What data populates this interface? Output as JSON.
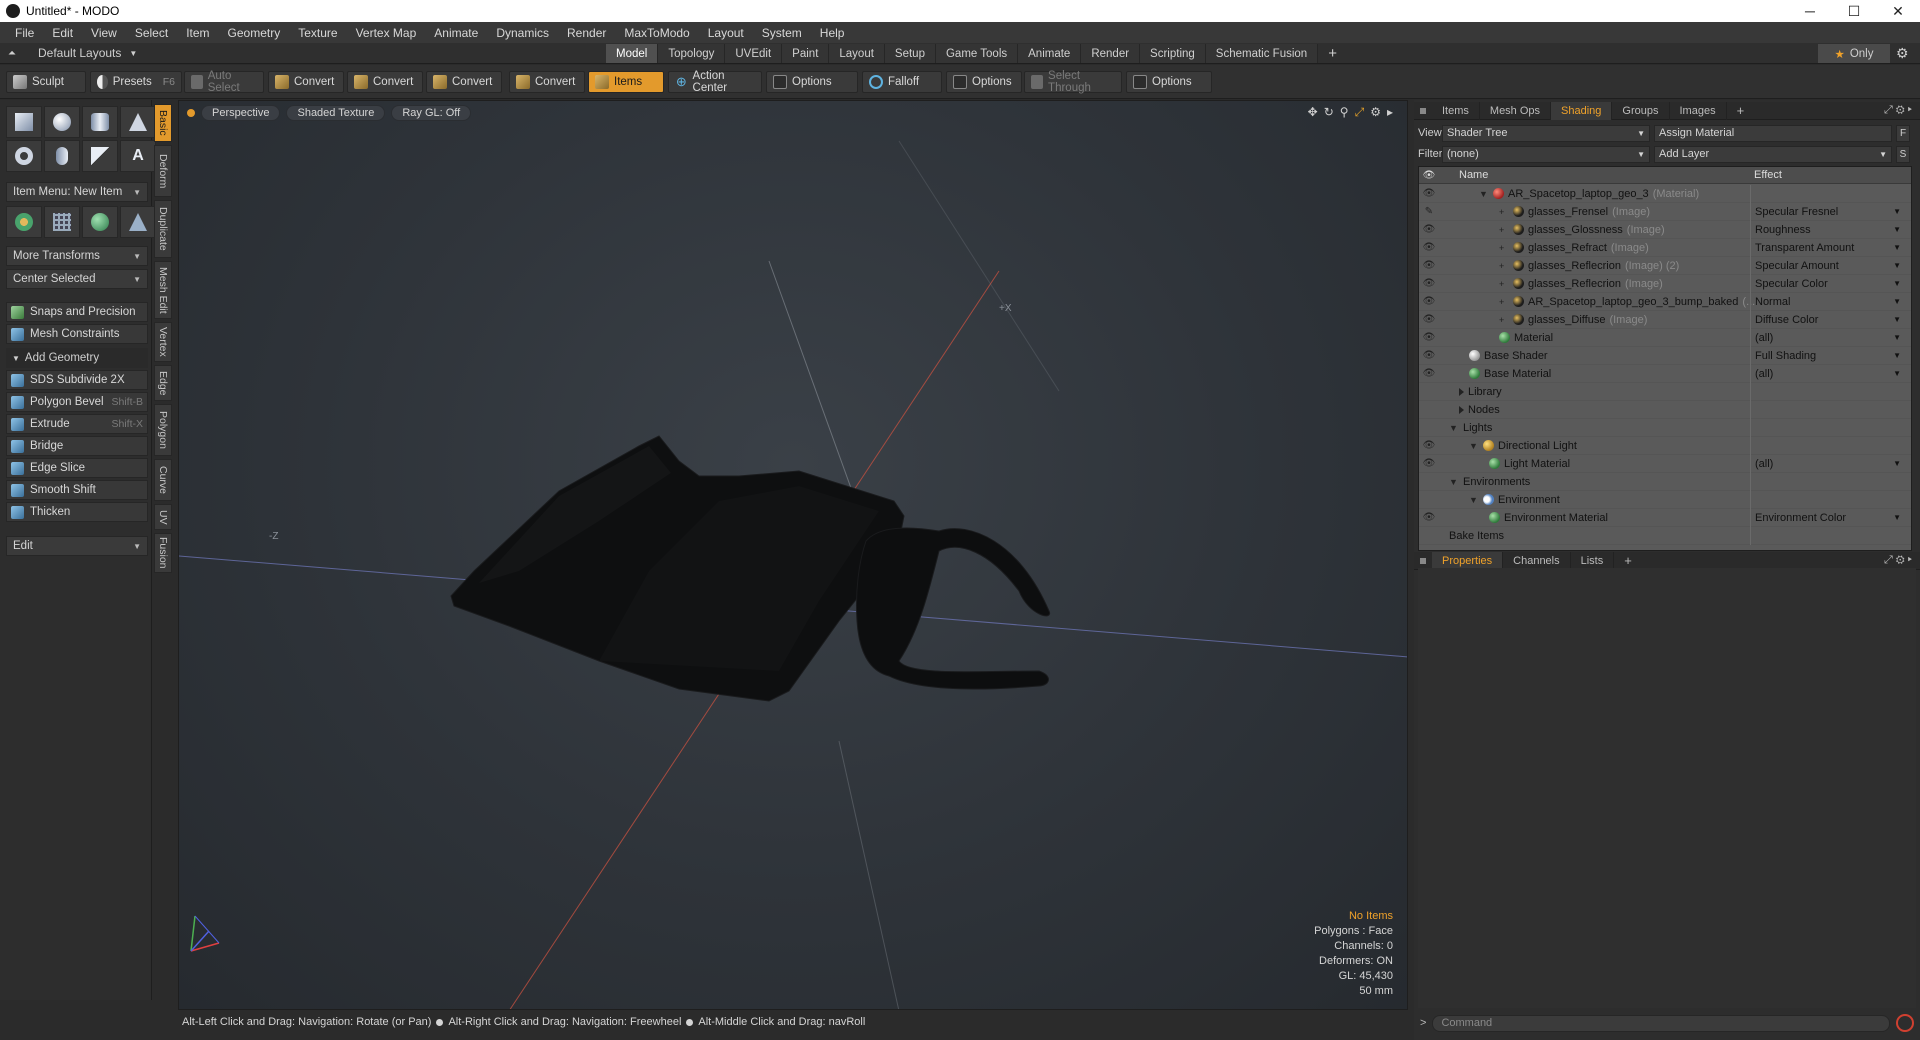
{
  "window": {
    "title": "Untitled* - MODO",
    "controls": [
      "─",
      "☐",
      "✕"
    ]
  },
  "menubar": [
    "File",
    "Edit",
    "View",
    "Select",
    "Item",
    "Geometry",
    "Texture",
    "Vertex Map",
    "Animate",
    "Dynamics",
    "Render",
    "MaxToModo",
    "Layout",
    "System",
    "Help"
  ],
  "layoutbar": {
    "layouts_label": "Default Layouts",
    "tabs": [
      "Model",
      "Topology",
      "UVEdit",
      "Paint",
      "Layout",
      "Setup",
      "Game Tools",
      "Animate",
      "Render",
      "Scripting",
      "Schematic Fusion"
    ],
    "active_tab": "Model",
    "plus": "+",
    "only_label": "Only"
  },
  "toolbar": {
    "sculpt": "Sculpt",
    "presets": "Presets",
    "presets_shortcut": "F6",
    "auto_select": "Auto Select",
    "convert1": "Convert",
    "convert2": "Convert",
    "convert3": "Convert",
    "convert4": "Convert",
    "items": "Items",
    "action_center": "Action Center",
    "options1": "Options",
    "falloff": "Falloff",
    "options2": "Options",
    "select_through": "Select Through",
    "options3": "Options"
  },
  "leftpanel": {
    "item_menu": "Item Menu: New Item",
    "more_transforms": "More Transforms",
    "center_selected": "Center Selected",
    "snaps": "Snaps and Precision",
    "mesh_constraints": "Mesh Constraints",
    "add_geometry": "Add Geometry",
    "tools": [
      {
        "label": "SDS Subdivide 2X",
        "shortcut": ""
      },
      {
        "label": "Polygon Bevel",
        "shortcut": "Shift-B"
      },
      {
        "label": "Extrude",
        "shortcut": "Shift-X"
      },
      {
        "label": "Bridge",
        "shortcut": ""
      },
      {
        "label": "Edge Slice",
        "shortcut": ""
      },
      {
        "label": "Smooth Shift",
        "shortcut": ""
      },
      {
        "label": "Thicken",
        "shortcut": ""
      }
    ],
    "edit": "Edit"
  },
  "sidetabs": [
    "Basic",
    "Deform",
    "Duplicate",
    "Mesh Edit",
    "Vertex",
    "Edge",
    "Polygon",
    "Curve",
    "UV",
    "Fusion"
  ],
  "viewport": {
    "perspective": "Perspective",
    "shading": "Shaded Texture",
    "raygl": "Ray GL: Off",
    "info": {
      "selection": "No Items",
      "polygons": "Polygons : Face",
      "channels": "Channels: 0",
      "deformers": "Deformers: ON",
      "gl": "GL: 45,430",
      "units": "50 mm"
    },
    "axis_labels": {
      "px": "+X",
      "mz": "-Z"
    }
  },
  "statusbar": {
    "hint1": "Alt-Left Click and Drag: Navigation: Rotate (or Pan)",
    "hint2": "Alt-Right Click and Drag: Navigation: Freewheel",
    "hint3": "Alt-Middle Click and Drag: navRoll"
  },
  "rightpanel": {
    "tabs": [
      "Items",
      "Mesh Ops",
      "Shading",
      "Groups",
      "Images"
    ],
    "active_tab": "Shading",
    "plus": "+",
    "view_label": "View",
    "view_value": "Shader Tree",
    "assign_material": "Assign Material",
    "assign_btn": "F",
    "filter_label": "Filter",
    "filter_value": "(none)",
    "add_layer": "Add Layer",
    "add_layer_btn": "S",
    "tree_header": {
      "name": "Name",
      "effect": "Effect"
    },
    "tree": [
      {
        "name": "AR_Spacetop_laptop_geo_3",
        "sub": "(Material)",
        "effect": "",
        "indent": 60,
        "icon": "red",
        "eye": true,
        "exp": "▼"
      },
      {
        "name": "glasses_Frensel",
        "sub": "(Image)",
        "effect": "Specular Fresnel",
        "indent": 80,
        "icon": "img",
        "eye": "brush",
        "exp": "+"
      },
      {
        "name": "glasses_Glossness",
        "sub": "(Image)",
        "effect": "Roughness",
        "indent": 80,
        "icon": "img",
        "eye": true,
        "exp": "+"
      },
      {
        "name": "glasses_Refract",
        "sub": "(Image)",
        "effect": "Transparent Amount",
        "indent": 80,
        "icon": "img",
        "eye": true,
        "exp": "+"
      },
      {
        "name": "glasses_Reflecrion",
        "sub": "(Image) (2)",
        "effect": "Specular Amount",
        "indent": 80,
        "icon": "img",
        "eye": true,
        "exp": "+"
      },
      {
        "name": "glasses_Reflecrion",
        "sub": "(Image)",
        "effect": "Specular Color",
        "indent": 80,
        "icon": "img",
        "eye": true,
        "exp": "+"
      },
      {
        "name": "AR_Spacetop_laptop_geo_3_bump_baked",
        "sub": "(...",
        "effect": "Normal",
        "indent": 80,
        "icon": "img",
        "eye": true,
        "exp": "+"
      },
      {
        "name": "glasses_Diffuse",
        "sub": "(Image)",
        "effect": "Diffuse Color",
        "indent": 80,
        "icon": "img",
        "eye": true,
        "exp": "+"
      },
      {
        "name": "Material",
        "sub": "",
        "effect": "(all)",
        "indent": 80,
        "icon": "mat",
        "eye": true,
        "exp": ""
      },
      {
        "name": "Base Shader",
        "sub": "",
        "effect": "Full Shading",
        "indent": 50,
        "icon": "white",
        "eye": true,
        "exp": ""
      },
      {
        "name": "Base Material",
        "sub": "",
        "effect": "(all)",
        "indent": 50,
        "icon": "mat",
        "eye": true,
        "exp": ""
      },
      {
        "name": "Library",
        "sub": "",
        "effect": "",
        "indent": 40,
        "icon": "folder",
        "eye": false,
        "exp": ""
      },
      {
        "name": "Nodes",
        "sub": "",
        "effect": "",
        "indent": 40,
        "icon": "folder",
        "eye": false,
        "exp": ""
      },
      {
        "name": "Lights",
        "sub": "",
        "effect": "",
        "indent": 30,
        "icon": "",
        "eye": false,
        "exp": "▼"
      },
      {
        "name": "Directional Light",
        "sub": "",
        "effect": "",
        "indent": 50,
        "icon": "light",
        "eye": true,
        "exp": "▼"
      },
      {
        "name": "Light Material",
        "sub": "",
        "effect": "(all)",
        "indent": 70,
        "icon": "mat",
        "eye": true,
        "exp": ""
      },
      {
        "name": "Environments",
        "sub": "",
        "effect": "",
        "indent": 30,
        "icon": "",
        "eye": false,
        "exp": "▼"
      },
      {
        "name": "Environment",
        "sub": "",
        "effect": "",
        "indent": 50,
        "icon": "env",
        "eye": false,
        "exp": "▼"
      },
      {
        "name": "Environment Material",
        "sub": "",
        "effect": "Environment Color",
        "indent": 70,
        "icon": "mat",
        "eye": true,
        "exp": ""
      },
      {
        "name": "Bake Items",
        "sub": "",
        "effect": "",
        "indent": 30,
        "icon": "",
        "eye": false,
        "exp": ""
      }
    ],
    "props_tabs": [
      "Properties",
      "Channels",
      "Lists"
    ],
    "props_active": "Properties",
    "command_placeholder": "Command"
  }
}
